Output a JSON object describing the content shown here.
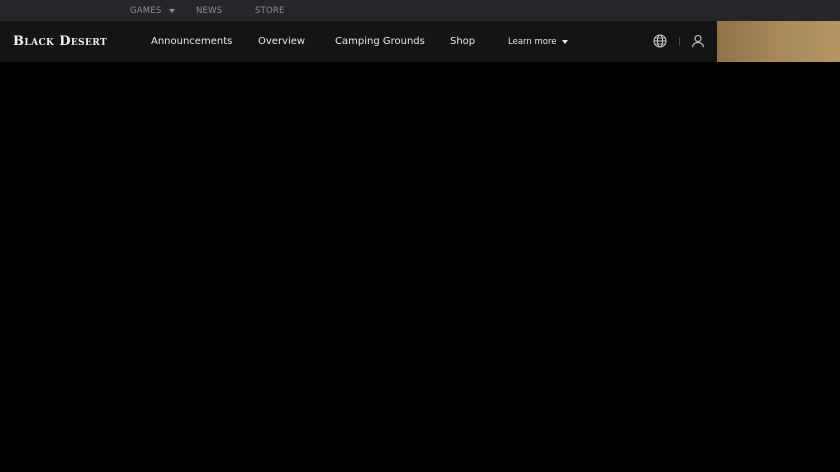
{
  "util_bar": {
    "games": "GAMES",
    "news": "NEWS",
    "store": "STORE"
  },
  "header": {
    "logo": "Black Desert",
    "nav": {
      "announcements": "Announcements",
      "overview": "Overview",
      "camping_grounds": "Camping Grounds",
      "shop": "Shop",
      "learn_more": "Learn more"
    },
    "icons": {
      "language": "globe-icon",
      "account": "user-icon"
    }
  },
  "colors": {
    "util_bar_bg": "#25262b",
    "nav_bg": "#141414",
    "page_bg": "#000000",
    "accent_gold": "#a7895a"
  }
}
